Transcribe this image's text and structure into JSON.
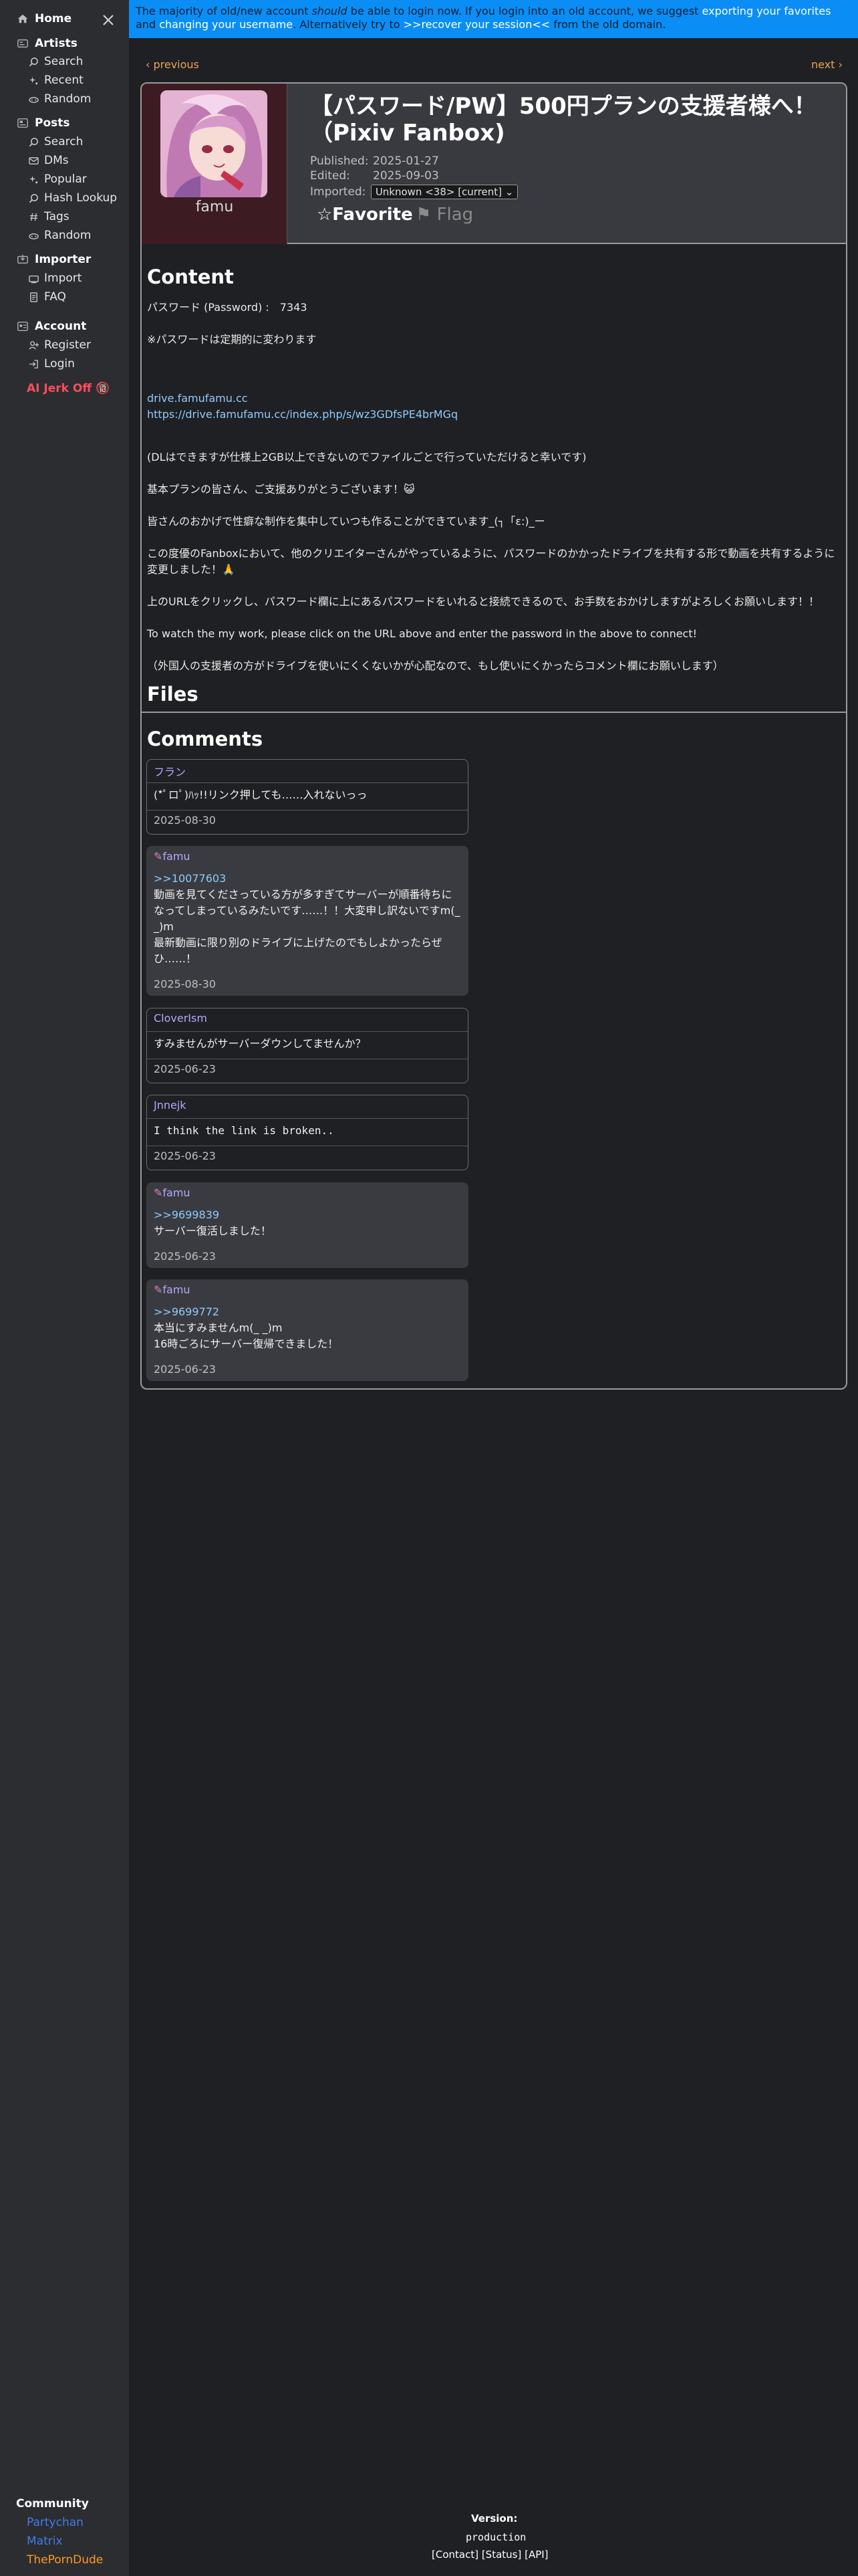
{
  "sidebar": {
    "home": "Home",
    "artists": {
      "label": "Artists",
      "items": [
        "Search",
        "Recent",
        "Random"
      ]
    },
    "posts": {
      "label": "Posts",
      "items": [
        "Search",
        "DMs",
        "Popular",
        "Hash Lookup",
        "Tags",
        "Random"
      ]
    },
    "importer": {
      "label": "Importer",
      "items": [
        "Import",
        "FAQ"
      ]
    },
    "account": {
      "label": "Account",
      "items": [
        "Register",
        "Login"
      ]
    },
    "ai_link": "AI Jerk Off 🔞",
    "community": {
      "label": "Community",
      "links": [
        {
          "label": "Partychan",
          "color": "#3f7de8"
        },
        {
          "label": "Matrix",
          "color": "#3f7de8"
        },
        {
          "label": "ThePornDude",
          "color": "#ff9a1f"
        }
      ]
    }
  },
  "banner": {
    "part1": "The majority of old/new account ",
    "part1_em": "should",
    "part2": " be able to login now. If you login into an old account, we suggest ",
    "link1": "exporting your favorites",
    "part3": " and ",
    "link2": "changing your username",
    "part4": ". Alternatively try to ",
    "link3": ">>recover your session<<",
    "part5": " from the old domain."
  },
  "nav": {
    "previous": "‹ previous",
    "next": "next ›"
  },
  "post": {
    "username": "famu",
    "title": "【パスワード/PW】500円プランの支援者様へ！（Pixiv Fanbox)",
    "published_label": "Published:",
    "published": "2025-01-27",
    "edited_label": "Edited:",
    "edited": "2025-09-03",
    "imported_label": "Imported:",
    "imported_value": "Unknown <38> [current]",
    "favorite": "☆Favorite",
    "flag": "⚑ Flag"
  },
  "content": {
    "heading": "Content",
    "password": "パスワード (Password) :　7343",
    "note": "※パスワードは定期的に変わります",
    "drive": "drive.famufamu.cc",
    "drive_url": "https://drive.famufamu.cc/index.php/s/wz3GDfsPE4brMGq",
    "line1": "(DLはできますが仕様上2GB以上できないのでファイルごとで行っていただけると幸いです)",
    "line2": "基本プランの皆さん、ご支援ありがとうございます！😺",
    "line3": "皆さんのおかげで性癖な制作を集中していつも作ることができています_(┐「ε:)_ー",
    "line4": "この度優のFanboxにおいて、他のクリエイターさんがやっているように、パスワードのかかったドライブを共有する形で動画を共有するように変更しました！🙏",
    "line5": "上のURLをクリックし、パスワード欄に上にあるパスワードをいれると接続できるので、お手数をおかけしますがよろしくお願いします！！",
    "line6": "To watch the my work, please click on the URL above and enter the password in the above to connect!",
    "line7": "（外国人の支援者の方がドライブを使いにくくないかが心配なので、もし使いにくかったらコメント欄にお願いします）"
  },
  "files": {
    "heading": "Files"
  },
  "comments": {
    "heading": "Comments",
    "list": [
      {
        "author": "フラン",
        "body": [
          "(*ﾟロﾟ)ﾊｯ!!リンク押しても……入れないっっ"
        ],
        "date": "2025-08-30"
      },
      {
        "author": "famu",
        "reply": ">>10077603",
        "body": [
          "動画を見てくださっている方が多すぎてサーバーが順番待ちになってしまっているみたいです……！！大変申し訳ないですm(_ _)m",
          "最新動画に限り別のドライブに上げたのでもしよかったらぜひ……！"
        ],
        "date": "2025-08-30"
      },
      {
        "author": "CloverIsm",
        "body": [
          "すみませんがサーバーダウンしてませんか？"
        ],
        "date": "2025-06-23"
      },
      {
        "author": "Jnnejk",
        "body": [
          "I think the link is broken.."
        ],
        "date": "2025-06-23"
      },
      {
        "author": "famu",
        "reply": ">>9699839",
        "body": [
          "サーバー復活しました！"
        ],
        "date": "2025-06-23"
      },
      {
        "author": "famu",
        "reply": ">>9699772",
        "body": [
          "本当にすみませんm(_ _)m",
          "16時ごろにサーバー復帰できました！"
        ],
        "date": "2025-06-23"
      }
    ]
  },
  "footer": {
    "version_label": "Version:",
    "version": "production",
    "links": "[Contact]  [Status]  [API]"
  }
}
